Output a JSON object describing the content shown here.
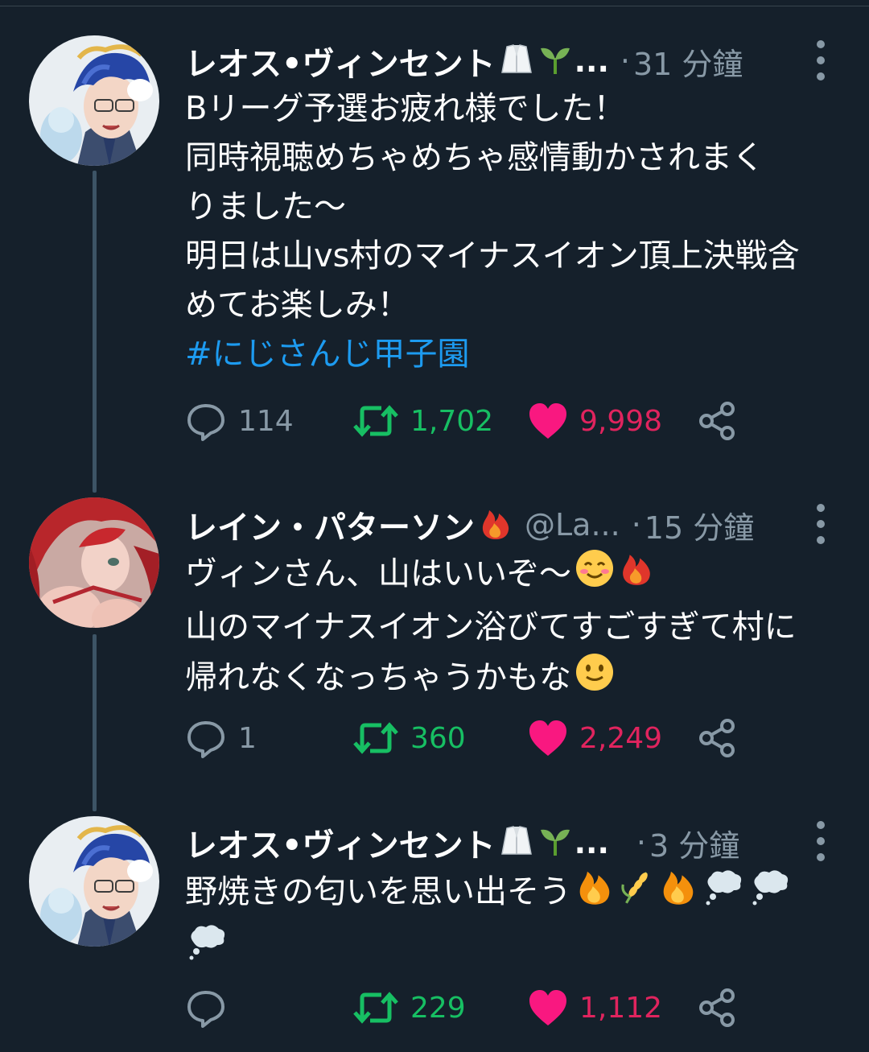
{
  "tweets": [
    {
      "name": "レオス•ヴィンセント",
      "name_emojis": [
        "lab-coat",
        "seedling"
      ],
      "ellipsis": "...",
      "handle": "",
      "dot": "·",
      "time": "31 分鐘",
      "lines": [
        "Bリーグ予選お疲れ様でした！",
        "同時視聴めちゃめちゃ感情動かされまく",
        "りました〜",
        "明日は山vs村のマイナスイオン頂上決戦含",
        "めてお楽しみ！"
      ],
      "hashtag": "#にじさんじ甲子園",
      "replies": "114",
      "retweets": "1,702",
      "likes": "9,998"
    },
    {
      "name": "レイン・パターソン",
      "name_emojis": [
        "fire"
      ],
      "handle": "@La...",
      "dot": "·",
      "time": "15 分鐘",
      "lines": [
        "ヴィンさん、山はいいぞ〜",
        "山のマイナスイオン浴びてすごすぎて村に",
        "帰れなくなっちゃうかもな"
      ],
      "line_emojis": [
        [
          "smiling-face",
          "fire"
        ],
        [],
        [
          "slightly-smiling-face"
        ]
      ],
      "replies": "1",
      "retweets": "360",
      "likes": "2,249"
    },
    {
      "name": "レオス•ヴィンセント",
      "name_emojis": [
        "lab-coat",
        "seedling"
      ],
      "ellipsis": "...",
      "handle": "",
      "dot": "·",
      "time": "3 分鐘",
      "lines": [
        "野焼きの匂いを思い出そう"
      ],
      "line_emojis": [
        [
          "fire",
          "rice-plant",
          "fire",
          "thought-balloon",
          "thought-balloon",
          "thought-balloon"
        ]
      ],
      "replies": "",
      "retweets": "229",
      "likes": "1,112"
    }
  ],
  "colors": {
    "background": "#15202b",
    "secondary_text": "#8899a6",
    "hashtag": "#1d9bf0",
    "retweet": "#17bf63",
    "like": "#e0245e",
    "thread_line": "#3d5466"
  },
  "icons": [
    "reply-icon",
    "retweet-icon",
    "heart-icon",
    "share-icon",
    "more-icon"
  ]
}
